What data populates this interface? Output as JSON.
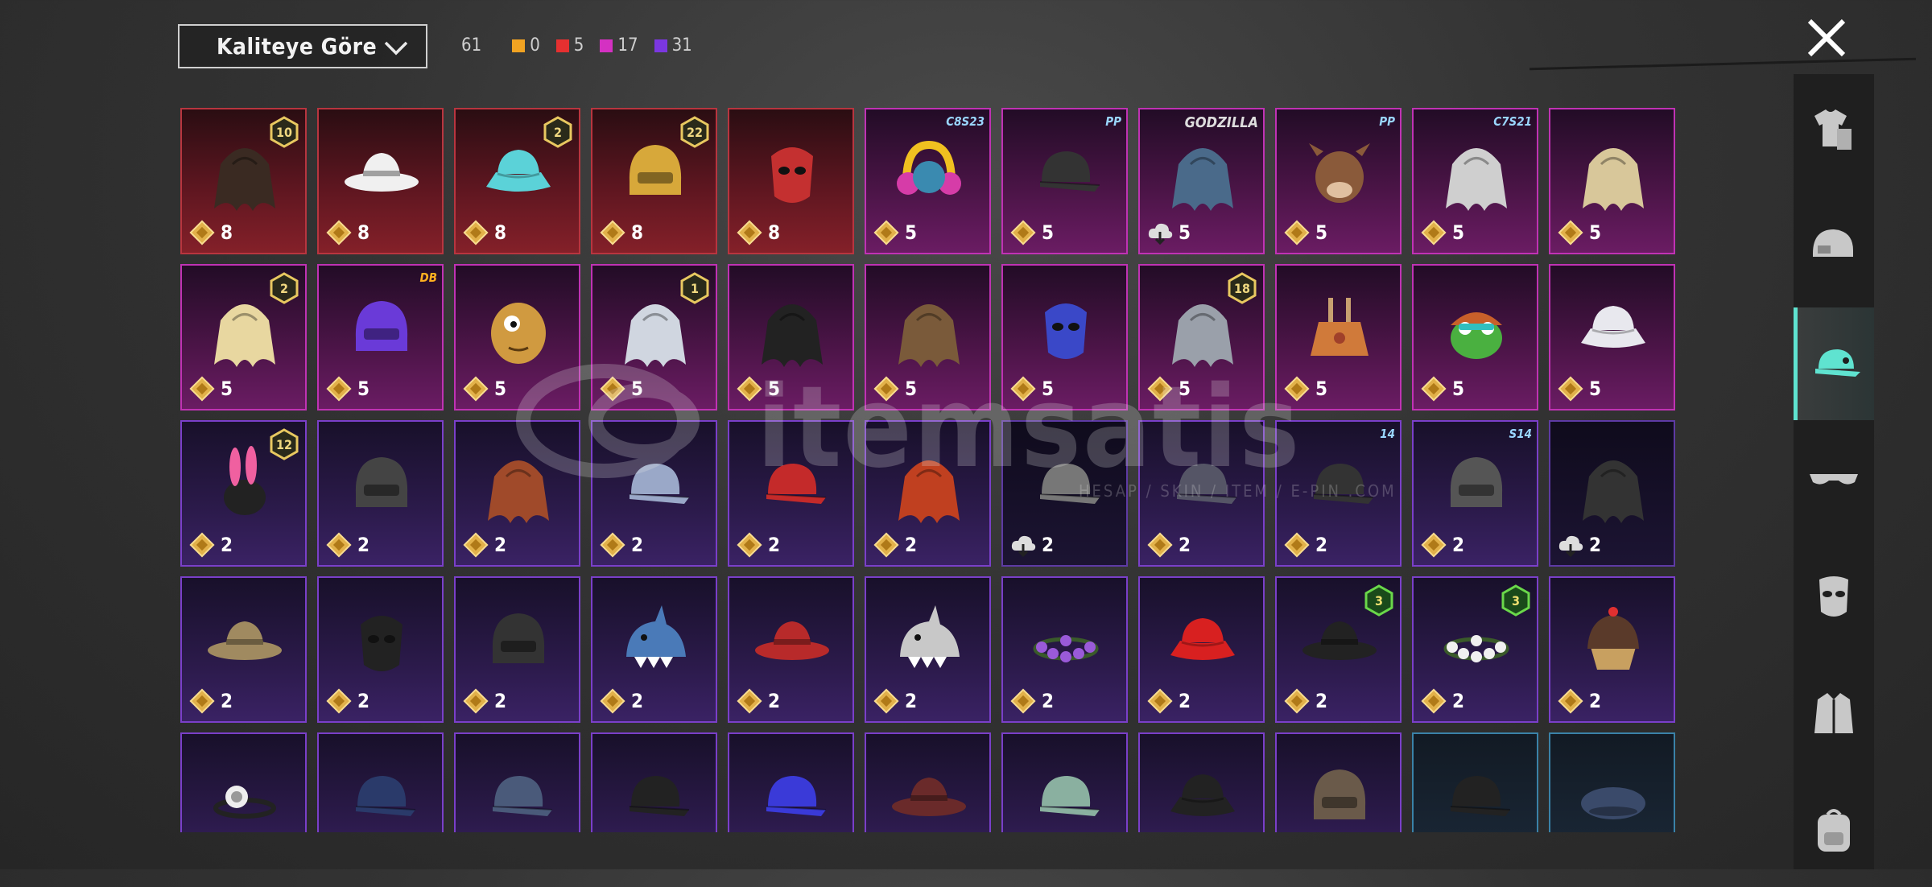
{
  "sort": {
    "label": "Kaliteye Göre",
    "icon": "chevron-down-icon"
  },
  "counts": {
    "total": "61",
    "by_quality": [
      {
        "color": "#f1a322",
        "value": "0",
        "name": "gold"
      },
      {
        "color": "#e53030",
        "value": "5",
        "name": "red"
      },
      {
        "color": "#d431c2",
        "value": "17",
        "name": "pink"
      },
      {
        "color": "#7b37e0",
        "value": "31",
        "name": "purple"
      }
    ]
  },
  "close_icon": "close-icon",
  "watermark": {
    "text": "itemsatis",
    "subtext": "HESAP / SKIN / ITEM / E-PIN .COM"
  },
  "sidebar": {
    "items": [
      {
        "name": "outfit-tab",
        "icon": "shirt-icon",
        "active": false
      },
      {
        "name": "helmet-tab",
        "icon": "helmet-icon",
        "active": false
      },
      {
        "name": "hat-tab",
        "icon": "cap-icon",
        "active": true
      },
      {
        "name": "glasses-tab",
        "icon": "glasses-icon",
        "active": false
      },
      {
        "name": "mask-tab",
        "icon": "mask-icon",
        "active": false
      },
      {
        "name": "jacket-tab",
        "icon": "jacket-icon",
        "active": false
      },
      {
        "name": "backpack-tab",
        "icon": "backpack-icon",
        "active": false
      }
    ]
  },
  "grid": {
    "rows": [
      [
        {
          "q": "red",
          "art": "hair-icon",
          "c": "#3a2a22",
          "cost": "8",
          "badge": "10"
        },
        {
          "q": "red",
          "art": "hat-icon",
          "c": "#f0f0f0",
          "cost": "8"
        },
        {
          "q": "red",
          "art": "bucket-hat-icon",
          "c": "#5bd2d8",
          "cost": "8",
          "badge": "2"
        },
        {
          "q": "red",
          "art": "helmet-icon",
          "c": "#d7a83a",
          "cost": "8",
          "badge": "22"
        },
        {
          "q": "red",
          "art": "mask-icon",
          "c": "#c43030",
          "cost": "8"
        },
        {
          "q": "pink",
          "art": "headphones-icon",
          "c": "#f0c020",
          "cost": "5",
          "tag": "C8S23",
          "tagStyle": "blue"
        },
        {
          "q": "pink",
          "art": "cap-icon",
          "c": "#333",
          "cost": "5",
          "tag": "PP",
          "tagStyle": "blue"
        },
        {
          "q": "pink",
          "art": "hair-icon",
          "c": "#4a6a8a",
          "cost": "5",
          "tag": "GODZILLA",
          "tagStyle": "grey",
          "dark": true,
          "cloud": true
        },
        {
          "q": "pink",
          "art": "animal-head-icon",
          "c": "#8a5a3a",
          "cost": "5",
          "tag": "PP",
          "tagStyle": "blue"
        },
        {
          "q": "pink",
          "art": "hair-icon",
          "c": "#cfcfcf",
          "cost": "5",
          "tag": "C7S21",
          "tagStyle": "blue"
        },
        {
          "q": "pink",
          "art": "hair-icon",
          "c": "#d8c79a",
          "cost": "5"
        }
      ],
      [
        {
          "q": "pink",
          "art": "hair-icon",
          "c": "#e8d7a0",
          "cost": "5",
          "badge": "2"
        },
        {
          "q": "pink",
          "art": "helmet-icon",
          "c": "#6a3ad8",
          "cost": "5",
          "tag": "DB",
          "tagStyle": "dbz"
        },
        {
          "q": "pink",
          "art": "potato-head-icon",
          "c": "#d09a40",
          "cost": "5"
        },
        {
          "q": "pink",
          "art": "hair-icon",
          "c": "#d0d6e0",
          "cost": "5",
          "badge": "1"
        },
        {
          "q": "pink",
          "art": "hair-icon",
          "c": "#222",
          "cost": "5"
        },
        {
          "q": "pink",
          "art": "hair-icon",
          "c": "#7a5a3a",
          "cost": "5"
        },
        {
          "q": "pink",
          "art": "mask-icon",
          "c": "#3a48c8",
          "cost": "5"
        },
        {
          "q": "pink",
          "art": "hair-icon",
          "c": "#9aa0aa",
          "cost": "5",
          "badge": "18"
        },
        {
          "q": "pink",
          "art": "headgear-icon",
          "c": "#d07a3a",
          "cost": "5"
        },
        {
          "q": "pink",
          "art": "frog-hat-icon",
          "c": "#4ab040",
          "cost": "5"
        },
        {
          "q": "pink",
          "art": "bucket-hat-icon",
          "c": "#e8e8ee",
          "cost": "5"
        }
      ],
      [
        {
          "q": "purple",
          "art": "bunny-ears-icon",
          "c": "#222",
          "cost": "2",
          "badge": "12"
        },
        {
          "q": "purple",
          "art": "helmet-icon",
          "c": "#444",
          "cost": "2"
        },
        {
          "q": "purple",
          "art": "hair-icon",
          "c": "#a04a2a",
          "cost": "2"
        },
        {
          "q": "purple",
          "art": "cap-icon",
          "c": "#9aa8c8",
          "cost": "2"
        },
        {
          "q": "purple",
          "art": "cap-icon",
          "c": "#c42a2a",
          "cost": "2"
        },
        {
          "q": "purple",
          "art": "hair-icon",
          "c": "#c04020",
          "cost": "2"
        },
        {
          "q": "purple",
          "art": "cap-icon",
          "c": "#777",
          "cost": "2",
          "cloud": true,
          "dark": true
        },
        {
          "q": "purple",
          "art": "cap-icon",
          "c": "#556",
          "cost": "2"
        },
        {
          "q": "purple",
          "art": "cap-icon",
          "c": "#333",
          "cost": "2",
          "tag": "14",
          "tagStyle": "blue"
        },
        {
          "q": "purple",
          "art": "helmet-icon",
          "c": "#555",
          "cost": "2",
          "tag": "S14",
          "tagStyle": "blue"
        },
        {
          "q": "purple",
          "art": "hair-icon",
          "c": "#333",
          "cost": "2",
          "cloud": true,
          "dark": true
        }
      ],
      [
        {
          "q": "purple",
          "art": "hat-icon",
          "c": "#a08a60",
          "cost": "2"
        },
        {
          "q": "purple",
          "art": "mask-icon",
          "c": "#222",
          "cost": "2"
        },
        {
          "q": "purple",
          "art": "helmet-icon",
          "c": "#333",
          "cost": "2"
        },
        {
          "q": "purple",
          "art": "shark-hat-icon",
          "c": "#4a7ab8",
          "cost": "2"
        },
        {
          "q": "purple",
          "art": "hat-icon",
          "c": "#b82a2a",
          "cost": "2"
        },
        {
          "q": "purple",
          "art": "shark-hat-icon",
          "c": "#c8c8c8",
          "cost": "2"
        },
        {
          "q": "purple",
          "art": "flower-crown-icon",
          "c": "#9a5ad8",
          "cost": "2"
        },
        {
          "q": "purple",
          "art": "bucket-hat-icon",
          "c": "#d82020",
          "cost": "2"
        },
        {
          "q": "purple",
          "art": "hat-icon",
          "c": "#222",
          "cost": "2",
          "badge": "3",
          "badgeGreen": true
        },
        {
          "q": "purple",
          "art": "flower-crown-icon",
          "c": "#f0f0f0",
          "cost": "2",
          "badge": "3",
          "badgeGreen": true
        },
        {
          "q": "purple",
          "art": "cupcake-hat-icon",
          "c": "#d8c080",
          "cost": "2"
        }
      ],
      [
        {
          "q": "purple",
          "art": "headlamp-icon",
          "c": "#eee",
          "cost": ""
        },
        {
          "q": "purple",
          "art": "cap-icon",
          "c": "#2a3a6a",
          "cost": ""
        },
        {
          "q": "purple",
          "art": "cap-icon",
          "c": "#4a5a7a",
          "cost": ""
        },
        {
          "q": "purple",
          "art": "cap-icon",
          "c": "#222",
          "cost": ""
        },
        {
          "q": "purple",
          "art": "cap-icon",
          "c": "#3a3ad8",
          "cost": ""
        },
        {
          "q": "purple",
          "art": "hat-icon",
          "c": "#6a2a2a",
          "cost": ""
        },
        {
          "q": "purple",
          "art": "cap-icon",
          "c": "#8ab0a0",
          "cost": ""
        },
        {
          "q": "purple",
          "art": "bucket-hat-icon",
          "c": "#222",
          "cost": ""
        },
        {
          "q": "purple",
          "art": "helmet-icon",
          "c": "#6a5a4a",
          "cost": ""
        },
        {
          "q": "blue",
          "art": "cap-icon",
          "c": "#222",
          "cost": ""
        },
        {
          "q": "blue",
          "art": "beret-icon",
          "c": "#3a4a6a",
          "cost": ""
        }
      ]
    ]
  }
}
